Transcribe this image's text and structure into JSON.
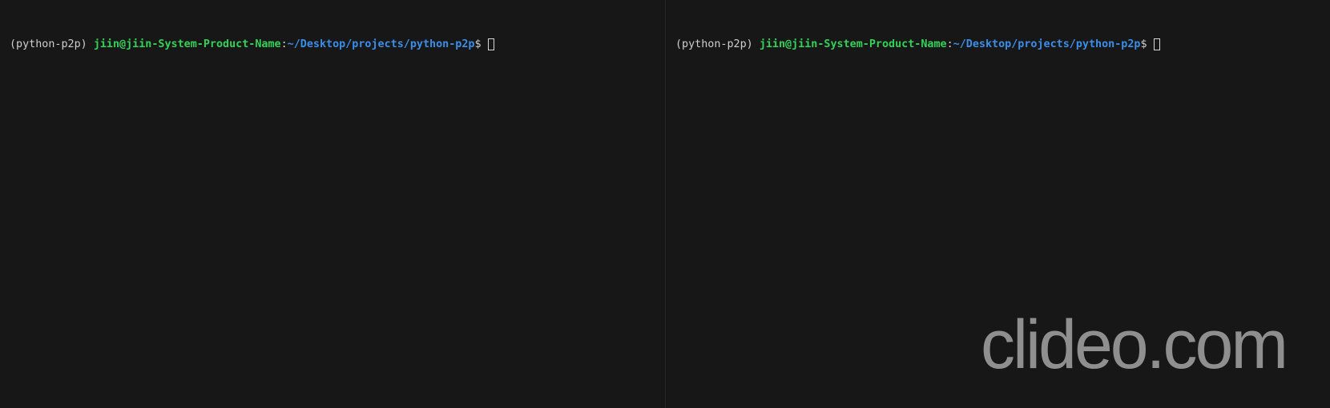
{
  "panes": {
    "left": {
      "venv": "(python-p2p)",
      "userhost": "jiin@jiin-System-Product-Name",
      "colon": ":",
      "cwd": "~/Desktop/projects/python-p2p",
      "dollar": "$"
    },
    "right": {
      "venv": "(python-p2p)",
      "userhost": "jiin@jiin-System-Product-Name",
      "colon": ":",
      "cwd": "~/Desktop/projects/python-p2p",
      "dollar": "$"
    }
  },
  "watermark": "clideo.com",
  "colors": {
    "background": "#171717",
    "userhost": "#34d058",
    "cwd": "#3b8ee8",
    "text": "#cfcfcf",
    "watermark": "#9a9a9a"
  }
}
